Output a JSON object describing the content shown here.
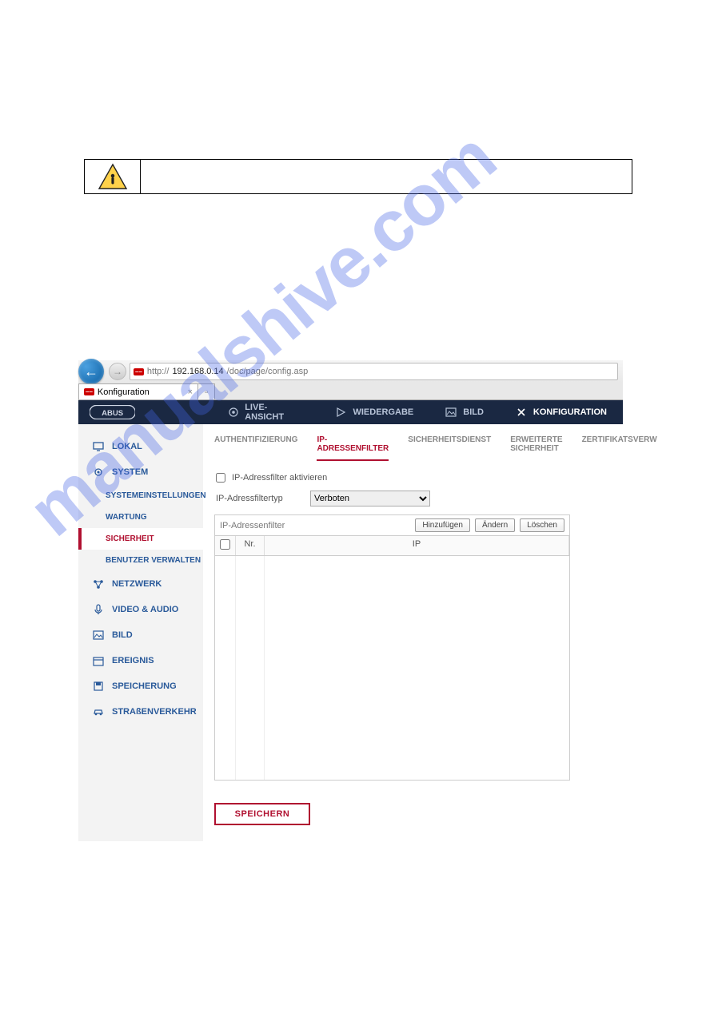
{
  "watermark": "manualshive.com",
  "browser": {
    "url_prefix": "http://",
    "url_host": "192.168.0.14",
    "url_path": "/doc/page/config.asp",
    "tab_title": "Konfiguration"
  },
  "header": {
    "items": [
      "LIVE-ANSICHT",
      "WIEDERGABE",
      "BILD",
      "KONFIGURATION"
    ]
  },
  "sidebar": {
    "lokal": "LOKAL",
    "system": "SYSTEM",
    "system_subs": [
      "SYSTEMEINSTELLUNGEN",
      "WARTUNG",
      "SICHERHEIT",
      "BENUTZER VERWALTEN"
    ],
    "netzwerk": "NETZWERK",
    "video_audio": "VIDEO & AUDIO",
    "bild": "BILD",
    "ereignis": "EREIGNIS",
    "speicherung": "SPEICHERUNG",
    "strassenverkehr": "STRAßENVERKEHR"
  },
  "subtabs": [
    "AUTHENTIFIZIERUNG",
    "IP-ADRESSENFILTER",
    "SICHERHEITSDIENST",
    "ERWEITERTE SICHERHEIT",
    "ZERTIFIKATSVERW"
  ],
  "form": {
    "enable_label": "IP-Adressfilter aktivieren",
    "type_label": "IP-Adressfiltertyp",
    "type_value": "Verboten"
  },
  "panel": {
    "title": "IP-Adressenfilter",
    "add": "Hinzufügen",
    "edit": "Ändern",
    "delete": "Löschen",
    "col_nr": "Nr.",
    "col_ip": "IP"
  },
  "save": "SPEICHERN"
}
